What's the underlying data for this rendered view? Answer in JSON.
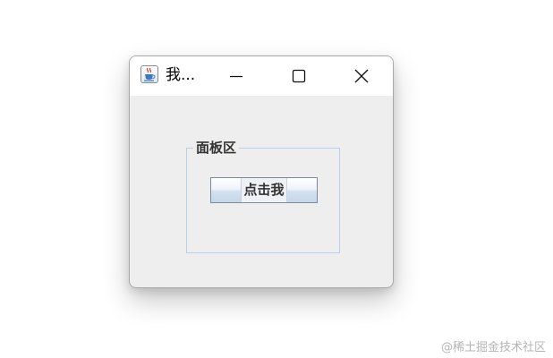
{
  "window": {
    "title": "我...",
    "app_icon": "java-coffee-cup-icon",
    "controls": {
      "minimize_icon": "minimize-icon",
      "maximize_icon": "maximize-icon",
      "close_icon": "close-icon"
    }
  },
  "panel": {
    "title": "面板区",
    "button_label": "点击我"
  },
  "watermark": {
    "text": "@稀土掘金技术社区"
  }
}
